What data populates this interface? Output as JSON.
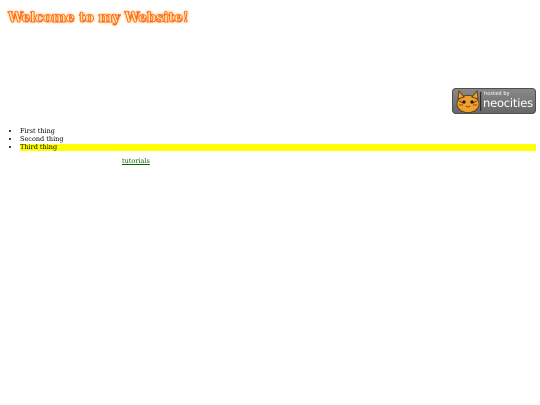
{
  "page": {
    "title": "Welcome to my Website!"
  },
  "badge": {
    "small_text": "hosted by",
    "big_text": "neocities",
    "icon": "neocities-cat-icon"
  },
  "list": {
    "items": [
      "First thing",
      "Second thing",
      "Third thing"
    ],
    "highlight_color": "#ffff00"
  },
  "link": {
    "label": "tutorials",
    "color": "#006400"
  },
  "colors": {
    "title_fill": "#ffe8a0",
    "title_glow": "#ff4a00",
    "background": "#ffffff"
  }
}
